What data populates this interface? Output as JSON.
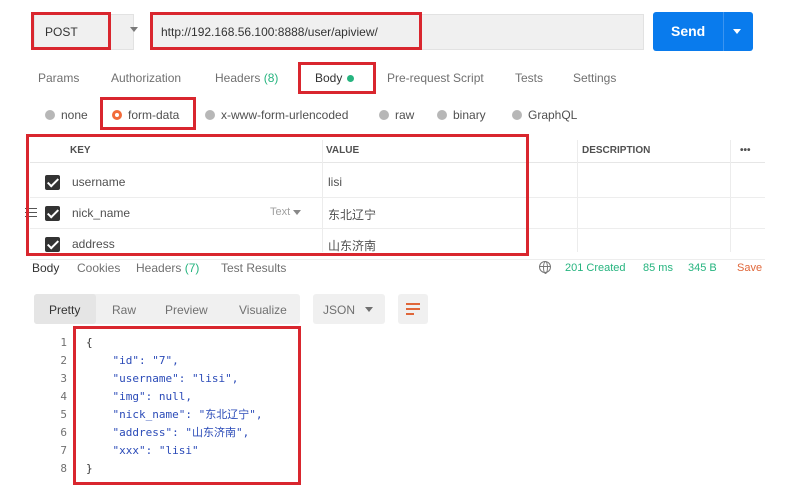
{
  "request": {
    "method": "POST",
    "url": "http://192.168.56.100:8888/user/apiview/",
    "send_label": "Send"
  },
  "tabs": [
    {
      "label": "Params"
    },
    {
      "label": "Authorization"
    },
    {
      "label": "Headers",
      "count": "(8)"
    },
    {
      "label": "Body"
    },
    {
      "label": "Pre-request Script"
    },
    {
      "label": "Tests"
    },
    {
      "label": "Settings"
    }
  ],
  "body_types": [
    "none",
    "form-data",
    "x-www-form-urlencoded",
    "raw",
    "binary",
    "GraphQL"
  ],
  "selected_body_type": "form-data",
  "table": {
    "headers": {
      "key": "KEY",
      "value": "VALUE",
      "description": "DESCRIPTION",
      "more": "•••"
    },
    "rows": [
      {
        "key": "username",
        "value": "lisi"
      },
      {
        "key": "nick_name",
        "value": "东北辽宁",
        "type": "Text"
      },
      {
        "key": "address",
        "value": "山东济南"
      }
    ]
  },
  "response_tabs": [
    {
      "label": "Body"
    },
    {
      "label": "Cookies"
    },
    {
      "label": "Headers",
      "count": "(7)"
    },
    {
      "label": "Test Results"
    }
  ],
  "status": {
    "code": "201 Created",
    "time": "85 ms",
    "size": "345 B",
    "save": "Save"
  },
  "toolbar": {
    "views": [
      "Pretty",
      "Raw",
      "Preview",
      "Visualize"
    ],
    "format": "JSON"
  },
  "code_lines": [
    {
      "n": "1",
      "t": "{"
    },
    {
      "n": "2",
      "t": "    \"id\": \"7\","
    },
    {
      "n": "3",
      "t": "    \"username\": \"lisi\","
    },
    {
      "n": "4",
      "t": "    \"img\": null,"
    },
    {
      "n": "5",
      "t": "    \"nick_name\": \"东北辽宁\","
    },
    {
      "n": "6",
      "t": "    \"address\": \"山东济南\","
    },
    {
      "n": "7",
      "t": "    \"xxx\": \"lisi\""
    },
    {
      "n": "8",
      "t": "}"
    }
  ],
  "colors": {
    "accent": "#097bed",
    "success": "#26b47f",
    "highlight": "#d9262e",
    "orange": "#f26b3a"
  }
}
